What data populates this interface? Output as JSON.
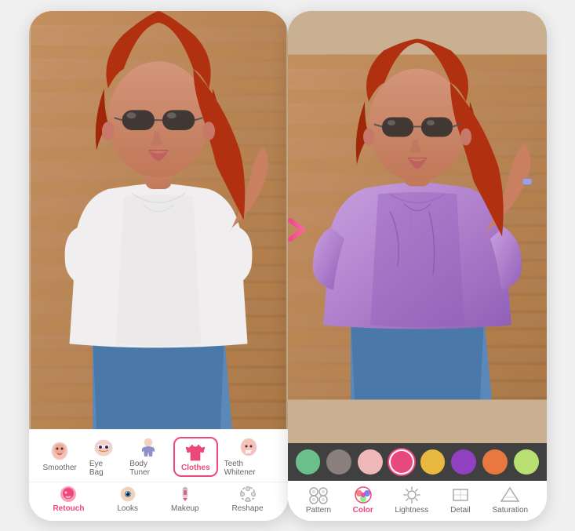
{
  "left_panel": {
    "toolbar": {
      "items": [
        {
          "id": "smoother",
          "label": "Smoother",
          "active": false
        },
        {
          "id": "eye-bag",
          "label": "Eye Bag",
          "active": false
        },
        {
          "id": "body-tuner",
          "label": "Body Tuner",
          "active": false
        },
        {
          "id": "clothes",
          "label": "Clothes",
          "active": true
        },
        {
          "id": "teeth-whitener",
          "label": "Teeth Whitener",
          "active": false
        }
      ]
    },
    "secondary": {
      "items": [
        {
          "id": "retouch",
          "label": "Retouch",
          "active": true
        },
        {
          "id": "looks",
          "label": "Looks",
          "active": false
        },
        {
          "id": "makeup",
          "label": "Makeup",
          "active": false
        },
        {
          "id": "reshape",
          "label": "Reshape",
          "active": false
        }
      ]
    }
  },
  "right_panel": {
    "color_swatches": [
      {
        "id": "green",
        "color": "#6bbf8a",
        "selected": false
      },
      {
        "id": "gray",
        "color": "#8a7f7a",
        "selected": false
      },
      {
        "id": "pink-light",
        "color": "#f0b8b8",
        "selected": false
      },
      {
        "id": "pink-hot",
        "color": "#e84880",
        "selected": true
      },
      {
        "id": "yellow",
        "color": "#e8b840",
        "selected": false
      },
      {
        "id": "purple",
        "color": "#9040c0",
        "selected": false
      },
      {
        "id": "orange",
        "color": "#e87840",
        "selected": false
      },
      {
        "id": "green-light",
        "color": "#b8e070",
        "selected": false
      }
    ],
    "tools": [
      {
        "id": "pattern",
        "label": "Pattern",
        "active": false
      },
      {
        "id": "color",
        "label": "Color",
        "active": true
      },
      {
        "id": "lightness",
        "label": "Lightness",
        "active": false
      },
      {
        "id": "detail",
        "label": "Detail",
        "active": false
      },
      {
        "id": "saturation",
        "label": "Saturation",
        "active": false
      }
    ]
  },
  "arrow": "→"
}
